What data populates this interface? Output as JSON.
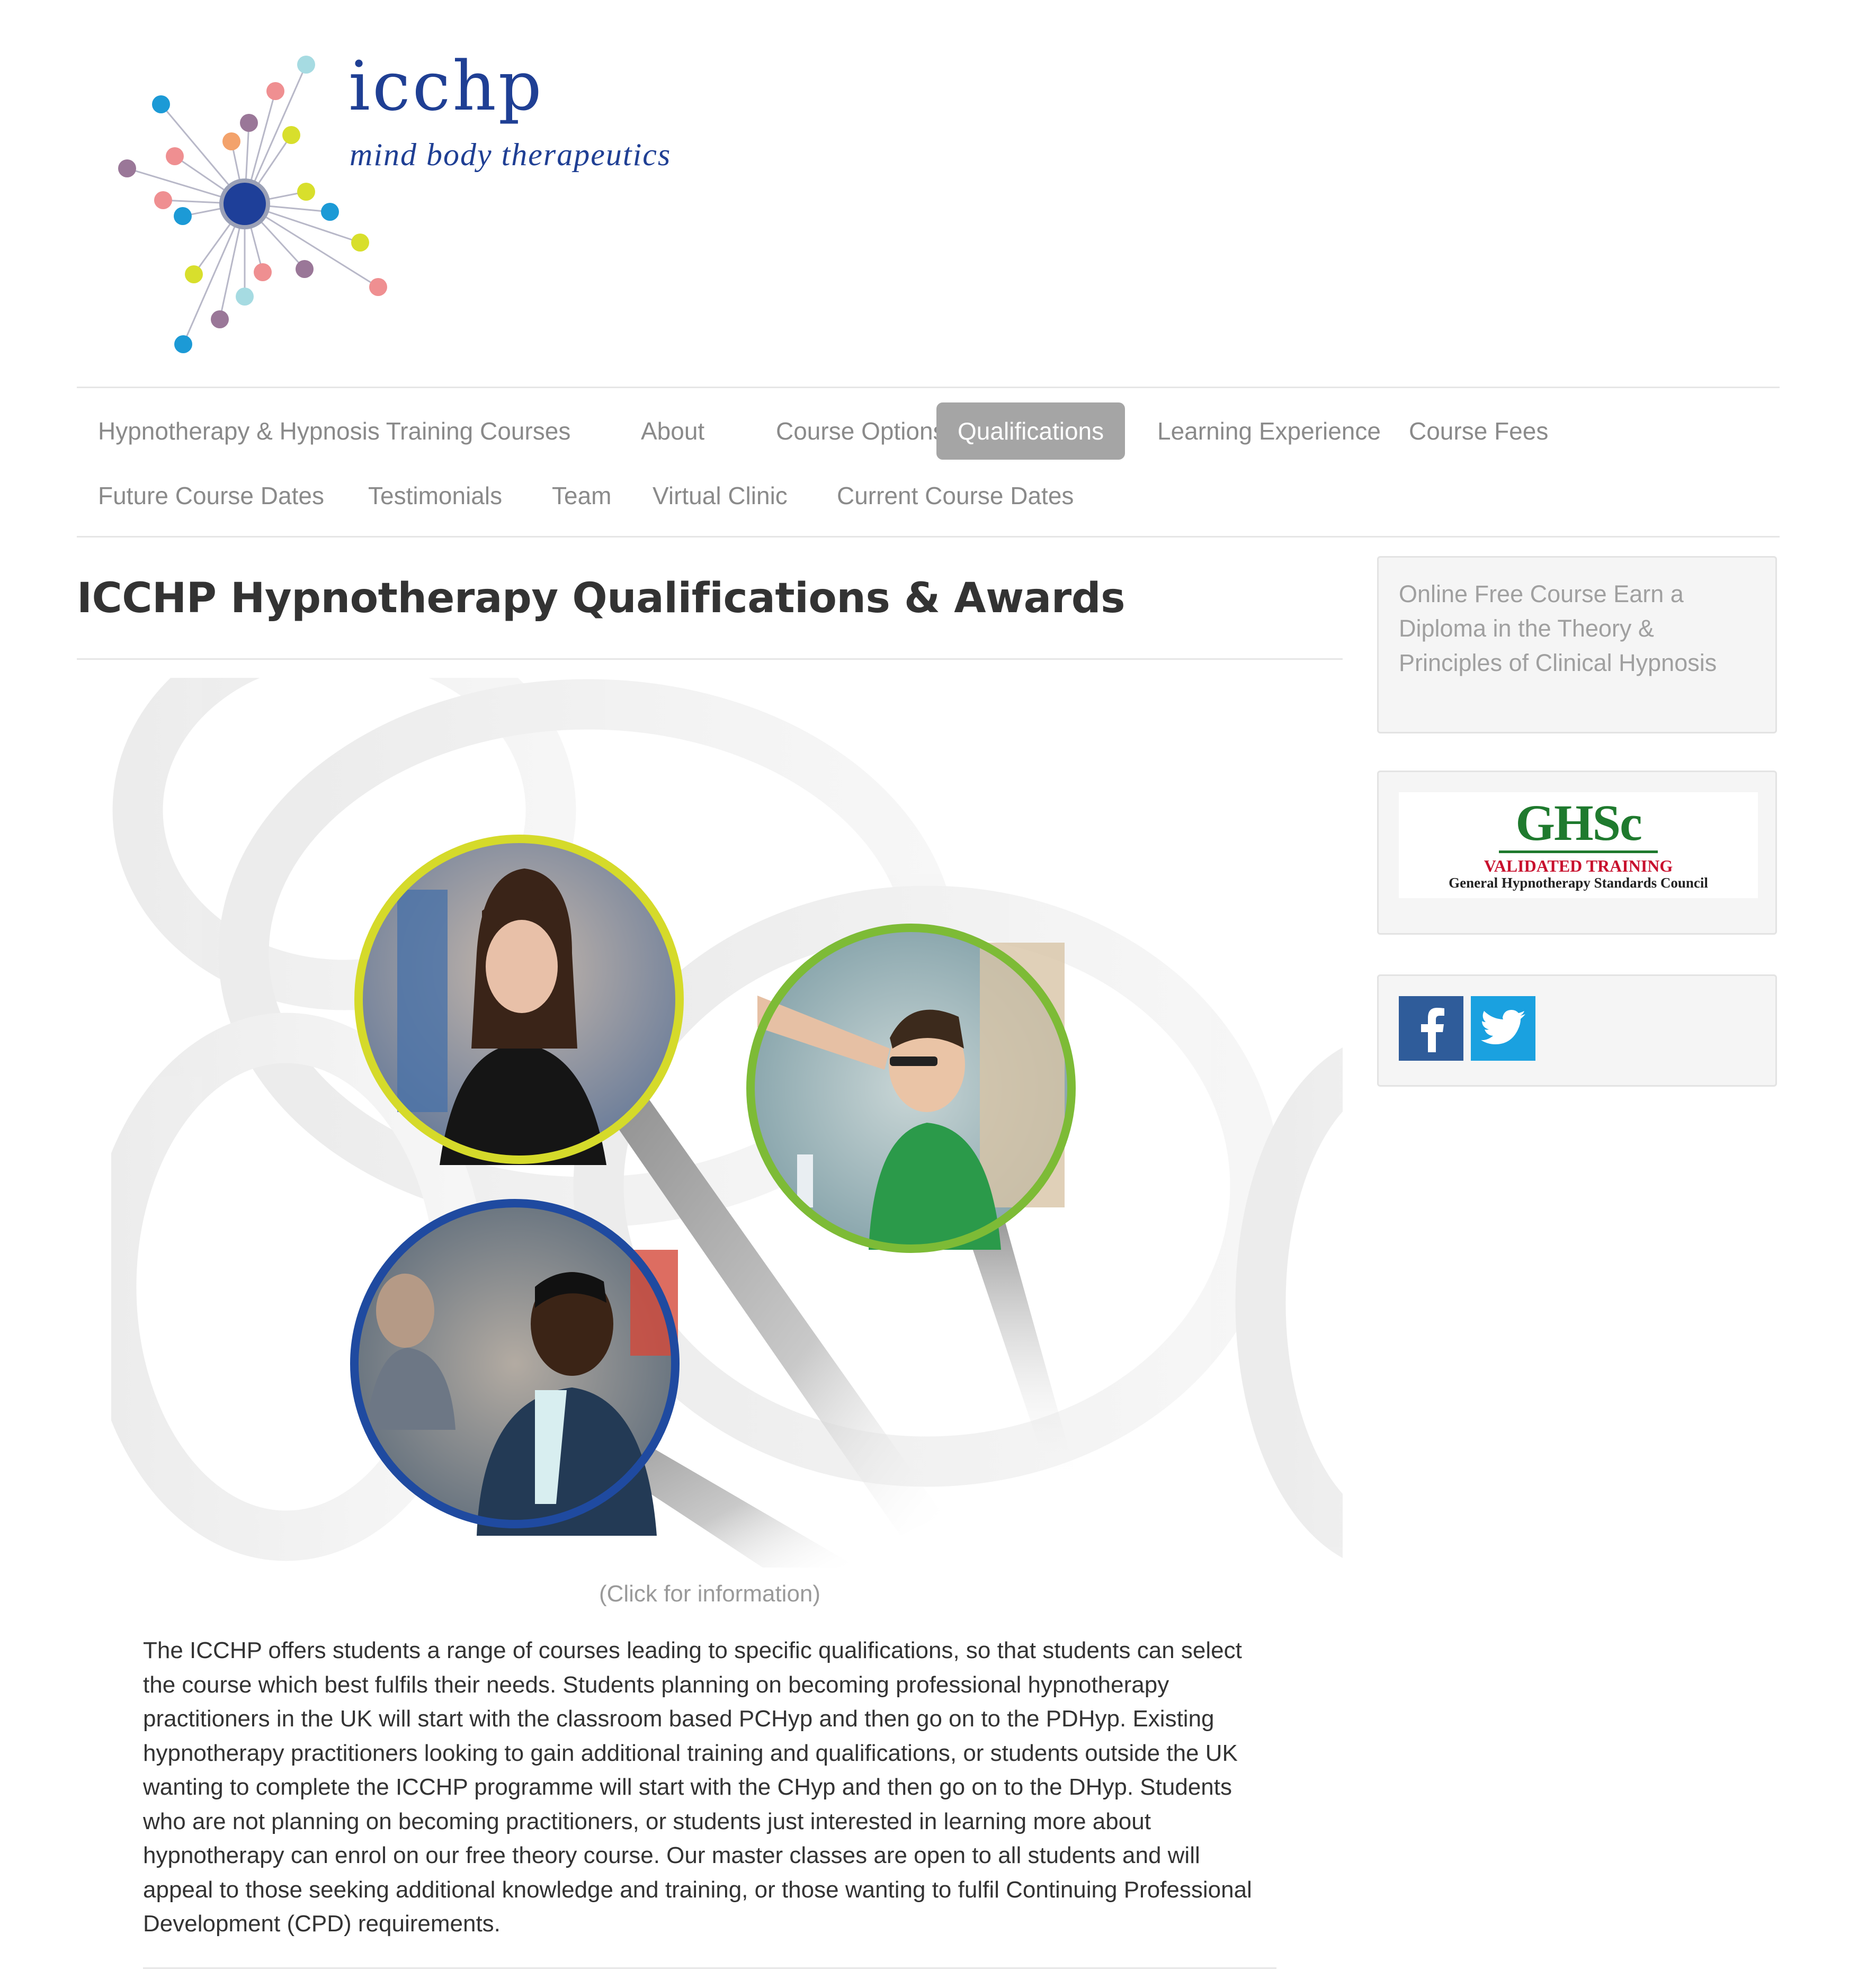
{
  "brand": {
    "title": "icchp",
    "subtitle": "mind body therapeutics",
    "logo_icon": "starburst-molecule-logo",
    "colors": {
      "brand_blue": "#1f3f94",
      "dot_blue": "#1c9ad6",
      "dot_pink": "#ef8f91",
      "dot_yellow": "#d8df2c",
      "dot_purple": "#9a7798",
      "dot_cyan": "#a6dbe2"
    }
  },
  "nav": {
    "items": [
      {
        "label": "Hypnotherapy & Hypnosis Training Courses",
        "active": false
      },
      {
        "label": "About",
        "active": false
      },
      {
        "label": "Course Options",
        "active": false
      },
      {
        "label": "Qualifications",
        "active": true
      },
      {
        "label": "Learning Experience",
        "active": false
      },
      {
        "label": "Course Fees",
        "active": false
      },
      {
        "label": "Future Course Dates",
        "active": false
      },
      {
        "label": "Testimonials",
        "active": false
      },
      {
        "label": "Team",
        "active": false
      },
      {
        "label": "Virtual Clinic",
        "active": false
      },
      {
        "label": "Current Course Dates",
        "active": false
      }
    ]
  },
  "main": {
    "title": "ICCHP Hypnotherapy Qualifications & Awards",
    "hero": {
      "rings": [
        {
          "name": "photo-ring-woman",
          "color": "#d5da2a"
        },
        {
          "name": "photo-ring-man-green-shirt",
          "color": "#7dbb36"
        },
        {
          "name": "photo-ring-man-cardigan",
          "color": "#1f4aa0"
        }
      ]
    },
    "caption": "(Click for information)",
    "body": "The ICCHP offers students a range of courses leading to specific qualifications, so that students can select the course which best fulfils their needs. Students planning on becoming professional hypnotherapy practitioners in the UK will start with the classroom based PCHyp and then go on to the PDHyp. Existing hypnotherapy practitioners looking to gain additional training and qualifications, or students outside the UK wanting to complete the ICCHP programme will start with the CHyp and then go on to the DHyp. Students who are not planning on becoming practitioners, or students just interested in learning more about hypnotherapy can enrol on our free theory course. Our master classes are open to all students and will appeal to those seeking additional knowledge and training, or those wanting to fulfil Continuing Professional Development (CPD) requirements."
  },
  "sidebar": {
    "course_link": "Online Free Course Earn a Diploma in the Theory & Principles of Clinical Hypnosis",
    "ghsc": {
      "logo_text": "GHSc",
      "validated": "VALIDATED TRAINING",
      "council": "General Hypnotherapy Standards Council"
    },
    "social": [
      {
        "icon": "facebook-icon",
        "color": "#2f5c9a"
      },
      {
        "icon": "twitter-icon",
        "color": "#1aa1e0"
      }
    ]
  }
}
